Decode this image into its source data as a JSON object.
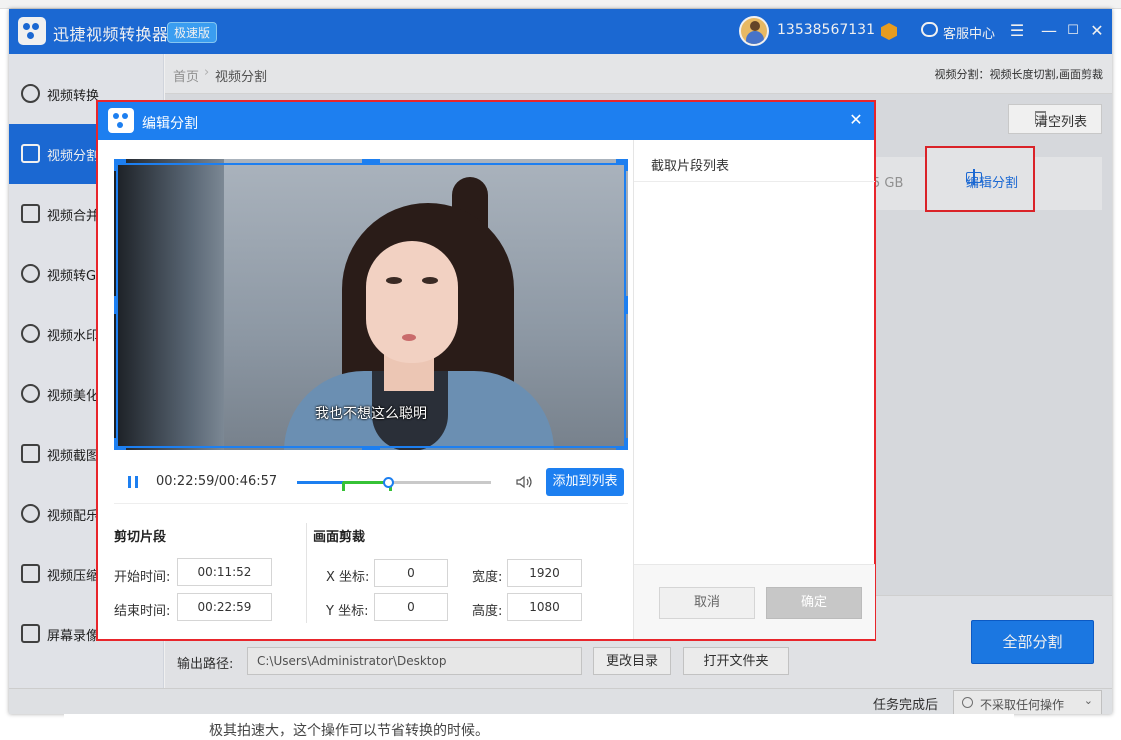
{
  "app": {
    "title": "迅捷视频转换器",
    "badge": "极速版",
    "phone": "13538567131",
    "service": "客服中心",
    "menu_glyph": "☰",
    "min_glyph": "—",
    "max_glyph": "☐",
    "close_glyph": "✕"
  },
  "sidebar": {
    "items": [
      {
        "label": "视频转换",
        "icon": "convert-icon"
      },
      {
        "label": "视频分割",
        "icon": "split-icon"
      },
      {
        "label": "视频合并",
        "icon": "merge-icon"
      },
      {
        "label": "视频转GIF",
        "icon": "gif-icon"
      },
      {
        "label": "视频水印",
        "icon": "watermark-icon"
      },
      {
        "label": "视频美化",
        "icon": "beautify-icon"
      },
      {
        "label": "视频截图",
        "icon": "screenshot-icon"
      },
      {
        "label": "视频配乐",
        "icon": "music-icon"
      },
      {
        "label": "视频压缩",
        "icon": "compress-icon"
      },
      {
        "label": "屏幕录像",
        "icon": "record-icon"
      }
    ]
  },
  "breadcrumb": {
    "home": "首页",
    "sep": "›",
    "current": "视频分割",
    "desc": "视频分割：视频长度切割,画面剪裁"
  },
  "toolbar": {
    "clear_label": "清空列表"
  },
  "file_row": {
    "size": "5 GB",
    "edit_label": "编辑分割"
  },
  "output": {
    "label": "输出路径:",
    "path": "C:\\Users\\Administrator\\Desktop",
    "change_dir": "更改目录",
    "open_folder": "打开文件夹"
  },
  "split_all": "全部分割",
  "status": {
    "after_label": "任务完成后",
    "after_value": "不采取任何操作",
    "chevron": "⌄"
  },
  "behind_text": "极其拍速大，这个操作可以节省转换的时候。",
  "dialog": {
    "title": "编辑分割",
    "close_glyph": "✕",
    "subtitle": "我也不想这么聪明",
    "time": "00:22:59/00:46:57",
    "progress": 0.47,
    "segment_start": 0.236,
    "segment_end": 0.478,
    "add_to_list": "添加到列表",
    "cut_section": {
      "title": "剪切片段",
      "start_label": "开始时间:",
      "start_value": "00:11:52",
      "end_label": "结束时间:",
      "end_value": "00:22:59"
    },
    "crop_section": {
      "title": "画面剪裁",
      "x_label": "X 坐标:",
      "x_value": "0",
      "y_label": "Y 坐标:",
      "y_value": "0",
      "w_label": "宽度:",
      "w_value": "1920",
      "h_label": "高度:",
      "h_value": "1080"
    },
    "list_title": "截取片段列表",
    "cancel": "取消",
    "confirm": "确定"
  },
  "colors": {
    "accent": "#1d7ff0",
    "highlight": "#e8252b",
    "segment": "#36c236"
  }
}
